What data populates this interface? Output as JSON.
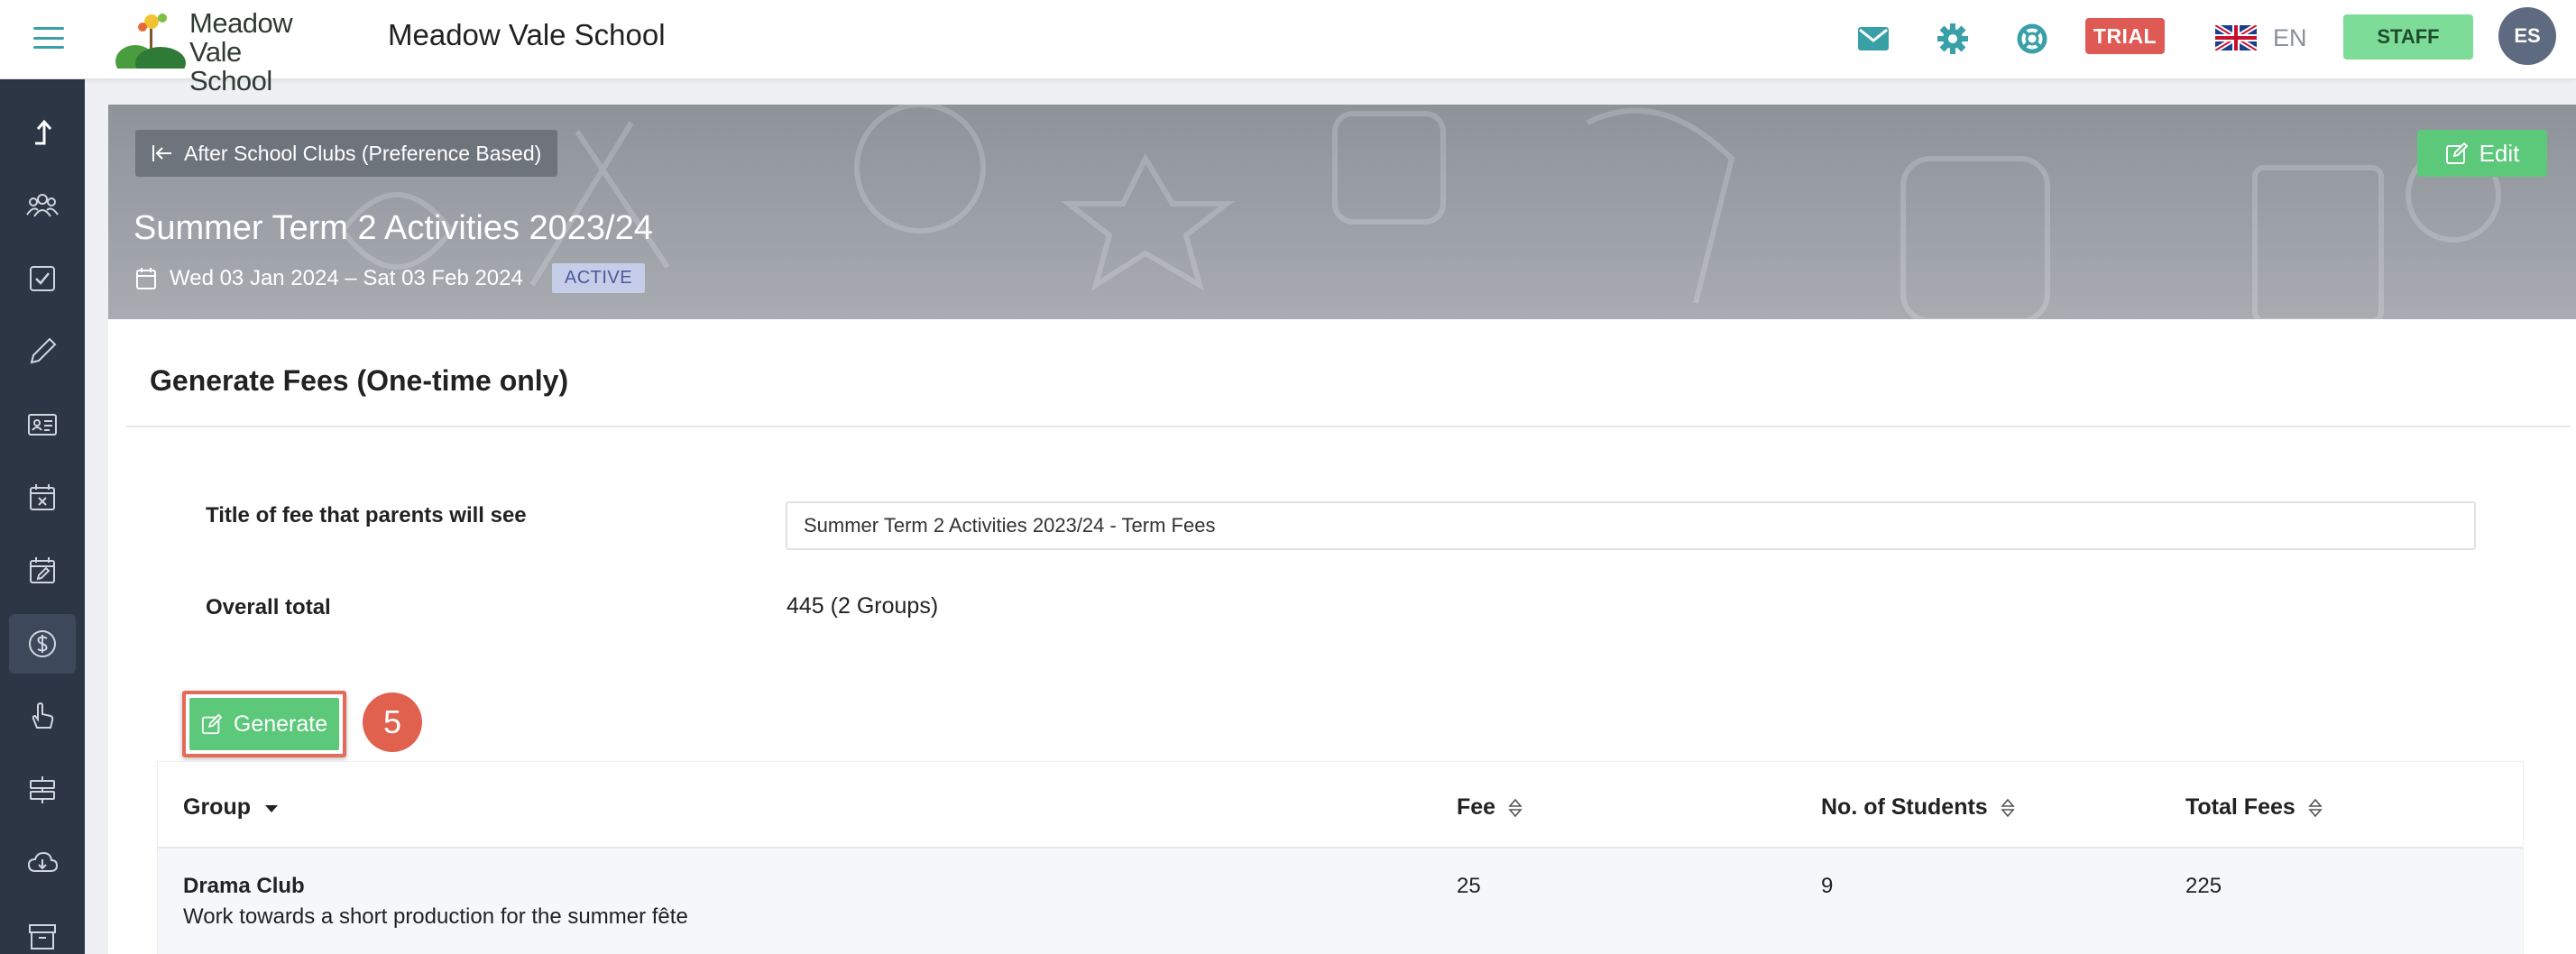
{
  "header": {
    "logo_line1": "Meadow",
    "logo_line2": "Vale School",
    "school_name": "Meadow Vale School",
    "trial_label": "TRIAL",
    "language": "EN",
    "staff_label": "STAFF",
    "user_initials": "ES",
    "icons": [
      "menu-icon",
      "envelope-icon",
      "gear-icon",
      "lifebuoy-icon",
      "uk-flag-icon"
    ]
  },
  "sidebar": {
    "items": [
      {
        "icon": "upload-arrow-icon"
      },
      {
        "icon": "people-icon"
      },
      {
        "icon": "checkbox-icon"
      },
      {
        "icon": "pencil-icon"
      },
      {
        "icon": "id-card-icon"
      },
      {
        "icon": "calendar-x-icon"
      },
      {
        "icon": "calendar-edit-icon"
      },
      {
        "icon": "dollar-icon",
        "active": true
      },
      {
        "icon": "hand-pointer-icon"
      },
      {
        "icon": "signpost-icon"
      },
      {
        "icon": "cloud-download-icon"
      },
      {
        "icon": "archive-icon"
      }
    ]
  },
  "banner": {
    "back_label": "After School Clubs (Preference Based)",
    "edit_label": "Edit",
    "title": "Summer Term 2 Activities 2023/24",
    "dates": "Wed 03 Jan 2024 – Sat 03 Feb 2024",
    "status": "ACTIVE"
  },
  "card": {
    "title": "Generate Fees (One-time only)",
    "fee_title_label": "Title of fee that parents will see",
    "fee_title_value": "Summer Term 2 Activities 2023/24 - Term Fees",
    "overall_label": "Overall total",
    "overall_value": "445 (2 Groups)",
    "generate_label": "Generate",
    "step_number": "5"
  },
  "table": {
    "columns": [
      "Group",
      "Fee",
      "No. of Students",
      "Total Fees"
    ],
    "rows": [
      {
        "group": "Drama Club",
        "description": "Work towards a short production for the summer fête",
        "fee": "25",
        "students": "9",
        "total": "225"
      }
    ]
  },
  "colors": {
    "accent_green": "#5cc87a",
    "staff_green": "#7ddc97",
    "trial_red": "#e05a55",
    "sidebar_bg": "#2c3645",
    "teal_icon": "#3aa0a8",
    "annotation_red": "#e0614e"
  }
}
